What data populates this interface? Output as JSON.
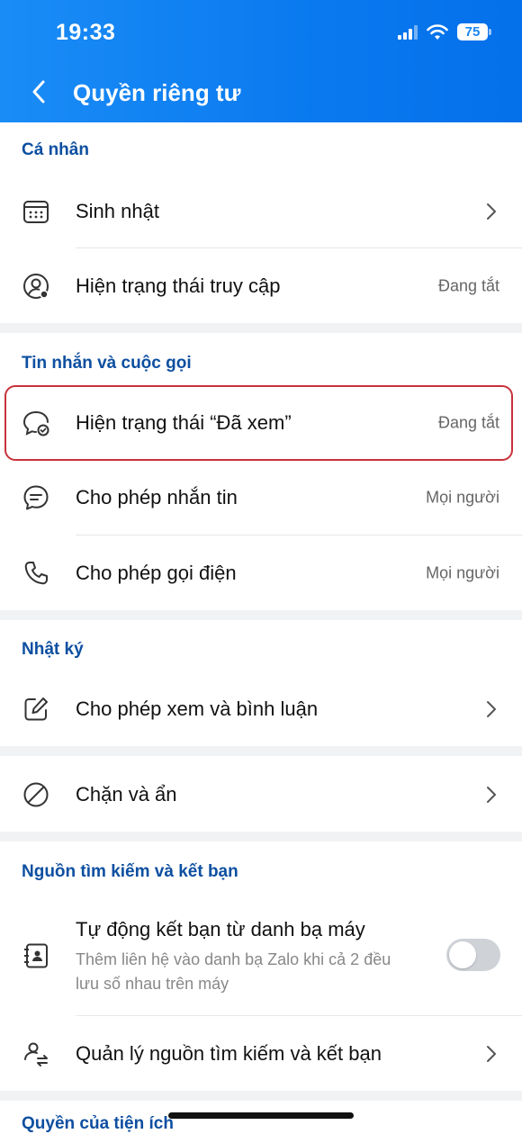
{
  "status_bar": {
    "time": "19:33",
    "battery": "75"
  },
  "nav": {
    "title": "Quyền riêng tư"
  },
  "sections": {
    "personal": {
      "header": "Cá nhân",
      "birthday": "Sinh nhật",
      "access_status": {
        "label": "Hiện trạng thái truy cập",
        "value": "Đang tắt"
      }
    },
    "messages_calls": {
      "header": "Tin nhắn và cuộc gọi",
      "seen_status": {
        "label": "Hiện trạng thái “Đã xem”",
        "value": "Đang tắt"
      },
      "allow_messages": {
        "label": "Cho phép nhắn tin",
        "value": "Mọi người"
      },
      "allow_calls": {
        "label": "Cho phép gọi điện",
        "value": "Mọi người"
      }
    },
    "diary": {
      "header": "Nhật ký",
      "view_comment": "Cho phép xem và bình luận"
    },
    "block": {
      "label": "Chặn và ẩn"
    },
    "search_friend": {
      "header": "Nguồn tìm kiếm và kết bạn",
      "auto_friend": {
        "label": "Tự động kết bạn từ danh bạ máy",
        "sub": "Thêm liên hệ vào danh bạ Zalo khi cả 2 đều lưu số nhau trên máy",
        "enabled": false
      },
      "manage_sources": "Quản lý nguồn tìm kiếm và kết bạn"
    },
    "next_section_header": "Quyền của tiện ích"
  },
  "colors": {
    "header_blue": "#0a79ef",
    "section_header": "#0d4fa0",
    "highlight_border": "#c8323c"
  }
}
